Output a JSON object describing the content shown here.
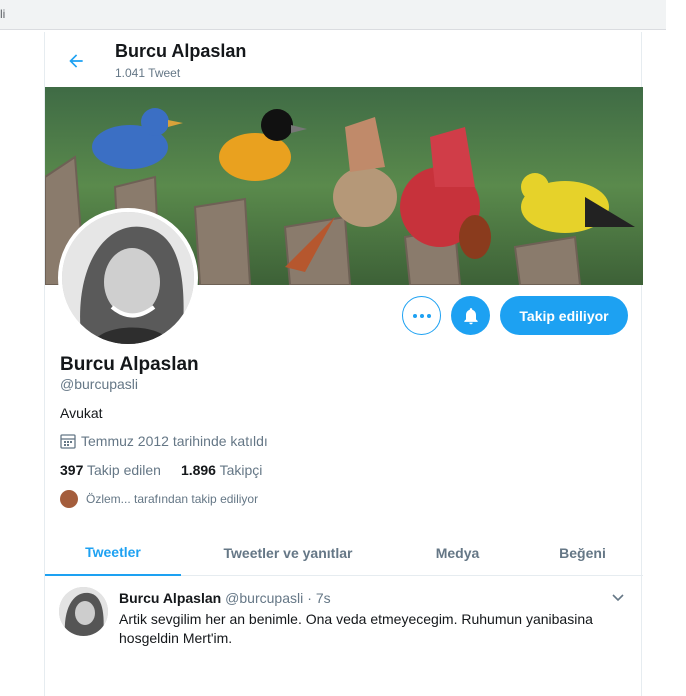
{
  "browser": {
    "address_fragment": "li"
  },
  "header": {
    "title": "Burcu Alpaslan",
    "subtitle": "1.041 Tweet",
    "back_icon": "arrow-left-icon"
  },
  "profile": {
    "name": "Burcu Alpaslan",
    "handle": "@burcupasli",
    "bio": "Avukat",
    "joined": "Temmuz 2012 tarihinde katıldı",
    "following_count": "397",
    "following_label": "Takip edilen",
    "followers_count": "1.896",
    "followers_label": "Takipçi",
    "followed_by": "Özlem... tarafından takip ediliyor"
  },
  "actions": {
    "follow_label": "Takip ediliyor",
    "more_icon": "more-icon",
    "bell_icon": "bell-icon"
  },
  "tabs": [
    {
      "label": "Tweetler",
      "active": true
    },
    {
      "label": "Tweetler ve yanıtlar",
      "active": false
    },
    {
      "label": "Medya",
      "active": false
    },
    {
      "label": "Beğeni",
      "active": false
    }
  ],
  "tweet": {
    "name": "Burcu Alpaslan",
    "handle": "@burcupasli",
    "separator": "·",
    "time": "7s",
    "text": "Artik sevgilim her an benimle. Ona veda etmeyecegim. Ruhumun yanibasina hosgeldin Mert'im."
  },
  "colors": {
    "accent": "#1da1f2",
    "secondary_text": "#657786",
    "border": "#e6ecf0"
  }
}
